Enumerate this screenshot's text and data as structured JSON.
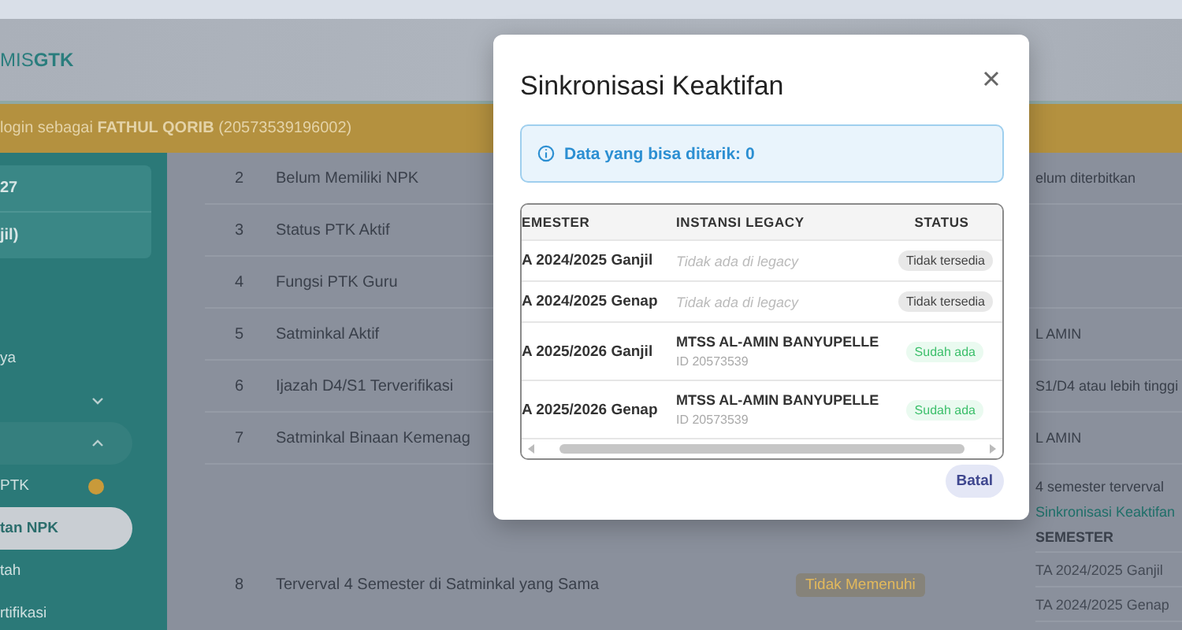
{
  "header": {
    "logo_light": "MIS",
    "logo_bold": "GTK"
  },
  "login_banner": "login sebagai **FATHUL QORIB** (20573539196002)",
  "sidebar": {
    "card_lines": [
      "27",
      "jil)"
    ],
    "items": [
      {
        "kind": "link",
        "label": "ya",
        "selected": false,
        "badge": false
      },
      {
        "kind": "group",
        "expanded": false
      },
      {
        "kind": "group",
        "expanded": true
      },
      {
        "kind": "link",
        "label": "PTK",
        "selected": false,
        "badge": true
      },
      {
        "kind": "link",
        "label": "tan NPK",
        "selected": true,
        "badge": false
      },
      {
        "kind": "link",
        "label": "tah",
        "selected": false,
        "badge": false
      },
      {
        "kind": "link",
        "label": "rtifikasi",
        "selected": false,
        "badge": false
      }
    ]
  },
  "criteria": [
    {
      "no": "2",
      "name": "Belum Memiliki NPK",
      "detail": "elum diterbitkan"
    },
    {
      "no": "3",
      "name": "Status PTK Aktif"
    },
    {
      "no": "4",
      "name": "Fungsi PTK Guru"
    },
    {
      "no": "5",
      "name": "Satminkal Aktif",
      "detail": "L AMIN"
    },
    {
      "no": "6",
      "name": "Ijazah D4/S1 Terverifikasi",
      "detail": "S1/D4 atau lebih tinggi"
    },
    {
      "no": "7",
      "name": "Satminkal Binaan Kemenag",
      "detail": "L AMIN"
    },
    {
      "no": "8",
      "name": "Terverval 4 Semester di Satminkal yang Sama",
      "status": "Tidak Memenuhi",
      "detail": "4 semester terverval",
      "link": "Sinkronisasi Keaktifan",
      "semester_header": "SEMESTER",
      "semesters": [
        "TA 2024/2025 Ganjil",
        "TA 2024/2025 Genap"
      ]
    }
  ],
  "modal": {
    "title": "Sinkronisasi Keaktifan",
    "info": "Data yang bisa ditarik: 0",
    "columns": [
      "EMESTER",
      "INSTANSI LEGACY",
      "STATUS"
    ],
    "rows": [
      {
        "semester": "A 2024/2025 Ganjil",
        "legacy": {
          "kind": "missing",
          "text": "Tidak ada di legacy"
        },
        "status": {
          "kind": "unavailable",
          "label": "Tidak tersedia"
        }
      },
      {
        "semester": "A 2024/2025 Genap",
        "legacy": {
          "kind": "missing",
          "text": "Tidak ada di legacy"
        },
        "status": {
          "kind": "unavailable",
          "label": "Tidak tersedia"
        }
      },
      {
        "semester": "A 2025/2026 Ganjil",
        "legacy": {
          "kind": "found",
          "name": "MTSS AL-AMIN BANYUPELLE",
          "id": "ID 20573539"
        },
        "status": {
          "kind": "exists",
          "label": "Sudah ada"
        }
      },
      {
        "semester": "A 2025/2026 Genap",
        "legacy": {
          "kind": "found",
          "name": "MTSS AL-AMIN BANYUPELLE",
          "id": "ID 20573539"
        },
        "status": {
          "kind": "exists",
          "label": "Sudah ada"
        }
      }
    ],
    "cancel": "Batal"
  }
}
